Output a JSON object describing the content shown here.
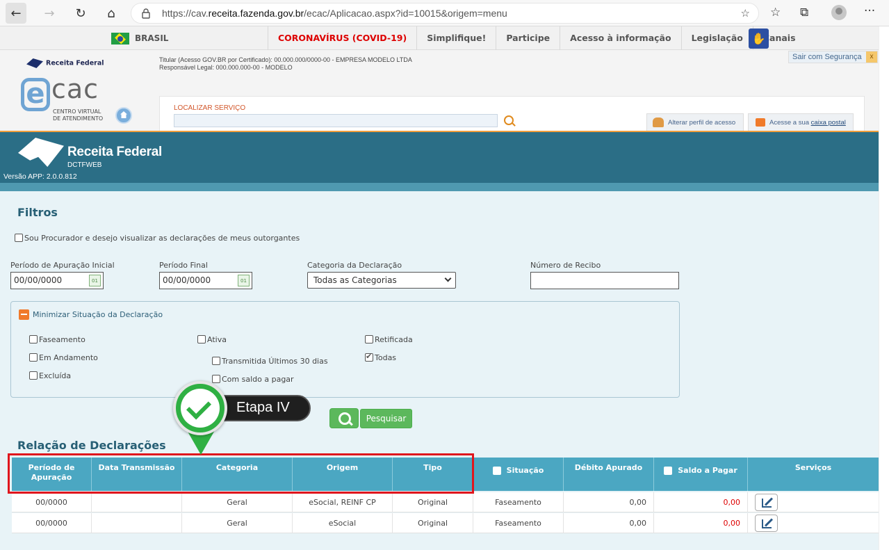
{
  "browser": {
    "url_prefix": "https://cav.",
    "url_host": "receita.fazenda.gov.br",
    "url_rest": "/ecac/Aplicacao.aspx?id=10015&origem=menu",
    "back_glyph": "←",
    "forward_glyph": "→",
    "reload_glyph": "↻",
    "home_glyph": "⌂",
    "favorites_add_glyph": "☆",
    "favorites_glyph": "☆",
    "collections_glyph": "⧉",
    "more_glyph": "···"
  },
  "gov_bar": {
    "brasil": "BRASIL",
    "links": [
      "CORONAVÍRUS (COVID-19)",
      "Simplifique!",
      "Participe",
      "Acesso à informação",
      "Legislação",
      "Canais"
    ],
    "accessibility_glyph": "✋"
  },
  "ecac": {
    "rf_small": "Receita Federal",
    "logo_e": "e",
    "logo_cac": "cac",
    "logo_sub1": "CENTRO VIRTUAL",
    "logo_sub2": "DE ATENDIMENTO",
    "titular": "Titular (Acesso GOV.BR por Certificado): 00.000.000/0000-00 - EMPRESA MODELO LTDA",
    "responsavel": "Responsável Legal: 000.000.000-00 - MODELO",
    "sair": "Sair com Segurança",
    "sair_close": "x",
    "search_label": "LOCALIZAR SERVIÇO",
    "perfil": "Alterar perfil de acesso",
    "caixa_prefix": "Acesse a sua ",
    "caixa_link": "caixa postal"
  },
  "banner": {
    "title": "Receita Federal",
    "subtitle": "DCTFWEB",
    "versao": "Versão APP: 2.0.0.812"
  },
  "filters": {
    "title": "Filtros",
    "procurador": "Sou Procurador e desejo visualizar as declarações de meus outorgantes",
    "periodo_inicial_label": "Período de Apuração Inicial",
    "periodo_inicial_value": "00/00/0000",
    "periodo_final_label": "Período Final",
    "periodo_final_value": "00/00/0000",
    "cal_text": "01",
    "categoria_label": "Categoria da Declaração",
    "categoria_value": "Todas as Categorias",
    "recibo_label": "Número de Recibo",
    "minimizar": "Minimizar Situação da Declaração",
    "situacoes": {
      "faseamento": "Faseamento",
      "em_andamento": "Em Andamento",
      "excluida": "Excluída",
      "ativa": "Ativa",
      "transmitida": "Transmitida Últimos 30 dias",
      "com_saldo": "Com saldo a pagar",
      "retificada": "Retificada",
      "todas": "Todas"
    },
    "pesquisar": "Pesquisar"
  },
  "badge": {
    "text": "Etapa IV"
  },
  "table": {
    "title": "Relação de Declarações",
    "headers": {
      "periodo": "Período de Apuração",
      "data_transmissao": "Data Transmissão",
      "categoria": "Categoria",
      "origem": "Origem",
      "tipo": "Tipo",
      "situacao": "Situação",
      "debito": "Débito Apurado",
      "saldo": "Saldo a Pagar",
      "servicos": "Serviços"
    },
    "rows": [
      {
        "periodo": "00/0000",
        "data": "",
        "categoria": "Geral",
        "origem": "eSocial, REINF CP",
        "tipo": "Original",
        "situacao": "Faseamento",
        "debito": "0,00",
        "saldo": "0,00"
      },
      {
        "periodo": "00/0000",
        "data": "",
        "categoria": "Geral",
        "origem": "eSocial",
        "tipo": "Original",
        "situacao": "Faseamento",
        "debito": "0,00",
        "saldo": "0,00"
      }
    ]
  }
}
